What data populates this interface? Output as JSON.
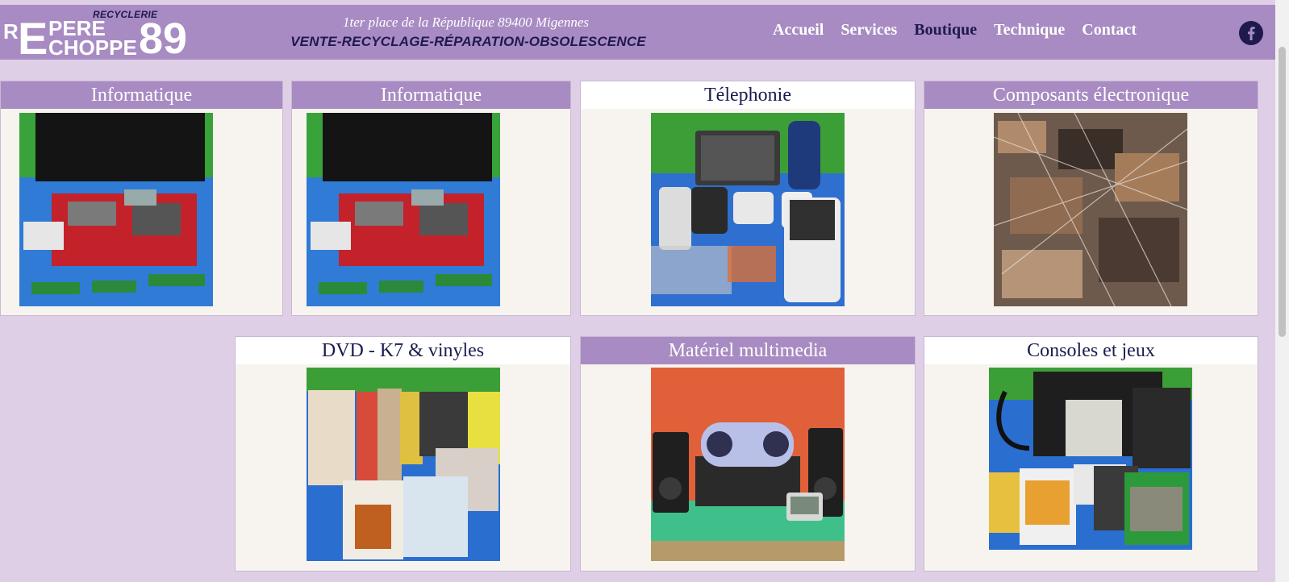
{
  "header": {
    "logo": {
      "recyclerie": "RECYCLERIE",
      "r": "R",
      "e": "E",
      "pere": "PERE",
      "choppe": "CHOPPE",
      "number": "89"
    },
    "address": "1ter place de la République 89400 Migennes",
    "tagline": "VENTE-RECYCLAGE-RÉPARATION-OBSOLESCENCE",
    "nav": [
      {
        "label": "Accueil"
      },
      {
        "label": "Services"
      },
      {
        "label": "Boutique"
      },
      {
        "label": "Technique"
      },
      {
        "label": "Contact"
      }
    ],
    "social_icon": "facebook-icon"
  },
  "colors": {
    "header_bg": "#a88bc2",
    "page_bg": "#decfe6",
    "accent_dark": "#1e1a4e",
    "card_bg": "#f7f4ef"
  },
  "cards": [
    {
      "title": "Informatique",
      "image": "computer-parts-photo"
    },
    {
      "title": "Informatique",
      "image": "computer-parts-photo"
    },
    {
      "title": "Télephonie",
      "image": "phones-photo"
    },
    {
      "title": "Composants électronique",
      "image": "electronic-components-photo"
    },
    {
      "title": "DVD - K7 & vinyles",
      "image": "dvd-photo"
    },
    {
      "title": "Matériel multimedia",
      "image": "multimedia-photo"
    },
    {
      "title": "Consoles et jeux",
      "image": "consoles-photo"
    }
  ]
}
